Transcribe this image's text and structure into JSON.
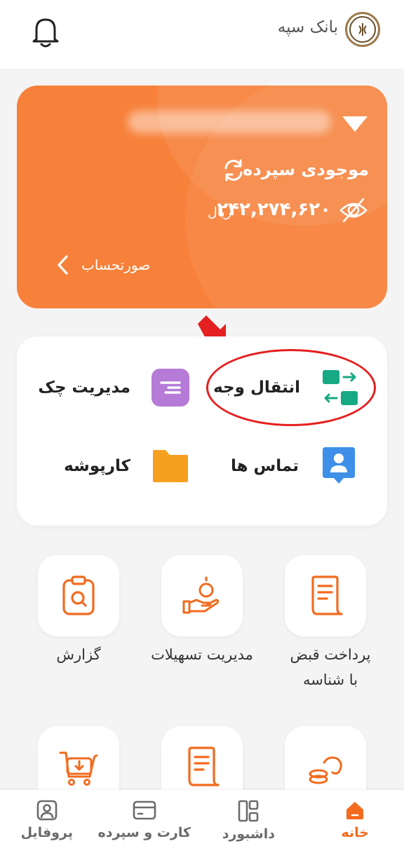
{
  "header": {
    "bank_name": "بانک سپه",
    "logo_text": "سپه"
  },
  "account": {
    "balance_label": "موجودی سپرده",
    "balance_amount": "۲۴۲,۲۷۴,۶۲۰",
    "currency": "ریال",
    "statement_label": "صورتحساب"
  },
  "quick_actions": [
    {
      "label": "انتقال وجه",
      "icon": "transfer-icon",
      "color": "#17a884"
    },
    {
      "label": "مدیریت چک",
      "icon": "check-icon",
      "color": "#b57bd6"
    },
    {
      "label": "تماس ها",
      "icon": "contacts-icon",
      "color": "#3d8fe8"
    },
    {
      "label": "کارپوشه",
      "icon": "folder-icon",
      "color": "#f5a01f"
    }
  ],
  "services": [
    {
      "label": "پرداخت قبض با شناسه",
      "icon": "bill-icon"
    },
    {
      "label": "مدیریت تسهیلات",
      "icon": "loan-icon"
    },
    {
      "label": "گزارش",
      "icon": "report-icon"
    }
  ],
  "nav": {
    "items": [
      {
        "label": "خانه",
        "icon": "home-icon",
        "active": true
      },
      {
        "label": "داشبورد",
        "icon": "dashboard-icon",
        "active": false
      },
      {
        "label": "کارت و سپرده",
        "icon": "card-icon",
        "active": false
      },
      {
        "label": "پروفایل",
        "icon": "profile-icon",
        "active": false
      }
    ]
  },
  "colors": {
    "accent": "#f7813a",
    "nav_active": "#f26b1f",
    "annotation": "#e52020"
  }
}
